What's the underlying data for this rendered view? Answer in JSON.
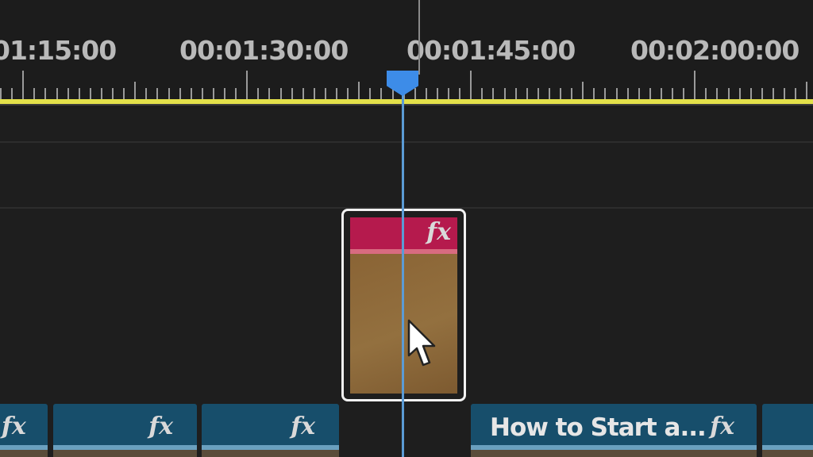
{
  "ruler": {
    "timecodes": [
      "01:15:00",
      "00:01:30:00",
      "00:01:45:00",
      "00:02:00:00"
    ]
  },
  "selected_clip": {
    "fx_label": "fx"
  },
  "v1_clips": [
    {
      "name": "",
      "fx_label": "fx"
    },
    {
      "name": "",
      "fx_label": "fx"
    },
    {
      "name": "",
      "fx_label": "fx"
    },
    {
      "name": "How to Start a...",
      "fx_label": "fx"
    },
    {
      "name": "",
      "fx_label": ""
    }
  ],
  "colors": {
    "background": "#1e1e1e",
    "work_area_bar": "#e3e04a",
    "playhead": "#3d8ce8",
    "selected_clip_header": "#b51a4d",
    "v1_clip": "#174e6b"
  }
}
